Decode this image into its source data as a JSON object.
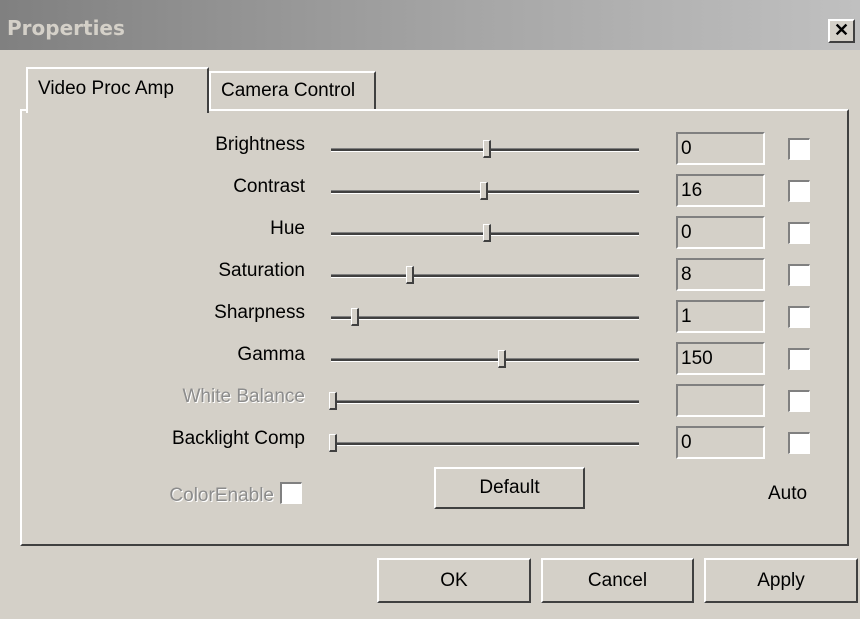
{
  "window": {
    "title": "Properties",
    "close_glyph": "✕",
    "close_icon": "close-icon"
  },
  "tabs": [
    {
      "label": "Video Proc Amp",
      "active": true
    },
    {
      "label": "Camera Control",
      "active": false
    }
  ],
  "properties": [
    {
      "name": "brightness",
      "label": "Brightness",
      "value": "0",
      "level": 0.5,
      "enabled": true,
      "auto": false
    },
    {
      "name": "contrast",
      "label": "Contrast",
      "value": "16",
      "level": 0.49,
      "enabled": true,
      "auto": false
    },
    {
      "name": "hue",
      "label": "Hue",
      "value": "0",
      "level": 0.5,
      "enabled": true,
      "auto": false
    },
    {
      "name": "saturation",
      "label": "Saturation",
      "value": "8",
      "level": 0.25,
      "enabled": true,
      "auto": false
    },
    {
      "name": "sharpness",
      "label": "Sharpness",
      "value": "1",
      "level": 0.07,
      "enabled": true,
      "auto": false
    },
    {
      "name": "gamma",
      "label": "Gamma",
      "value": "150",
      "level": 0.55,
      "enabled": true,
      "auto": false
    },
    {
      "name": "white-balance",
      "label": "White Balance",
      "value": "",
      "level": 0.0,
      "enabled": false,
      "auto": false
    },
    {
      "name": "backlight-comp",
      "label": "Backlight Comp",
      "value": "0",
      "level": 0.0,
      "enabled": true,
      "auto": false
    }
  ],
  "color_enable": {
    "label": "ColorEnable",
    "checked": false,
    "enabled": false
  },
  "default_button": "Default",
  "auto_label": "Auto",
  "footer": {
    "ok": "OK",
    "cancel": "Cancel",
    "apply": "Apply"
  }
}
